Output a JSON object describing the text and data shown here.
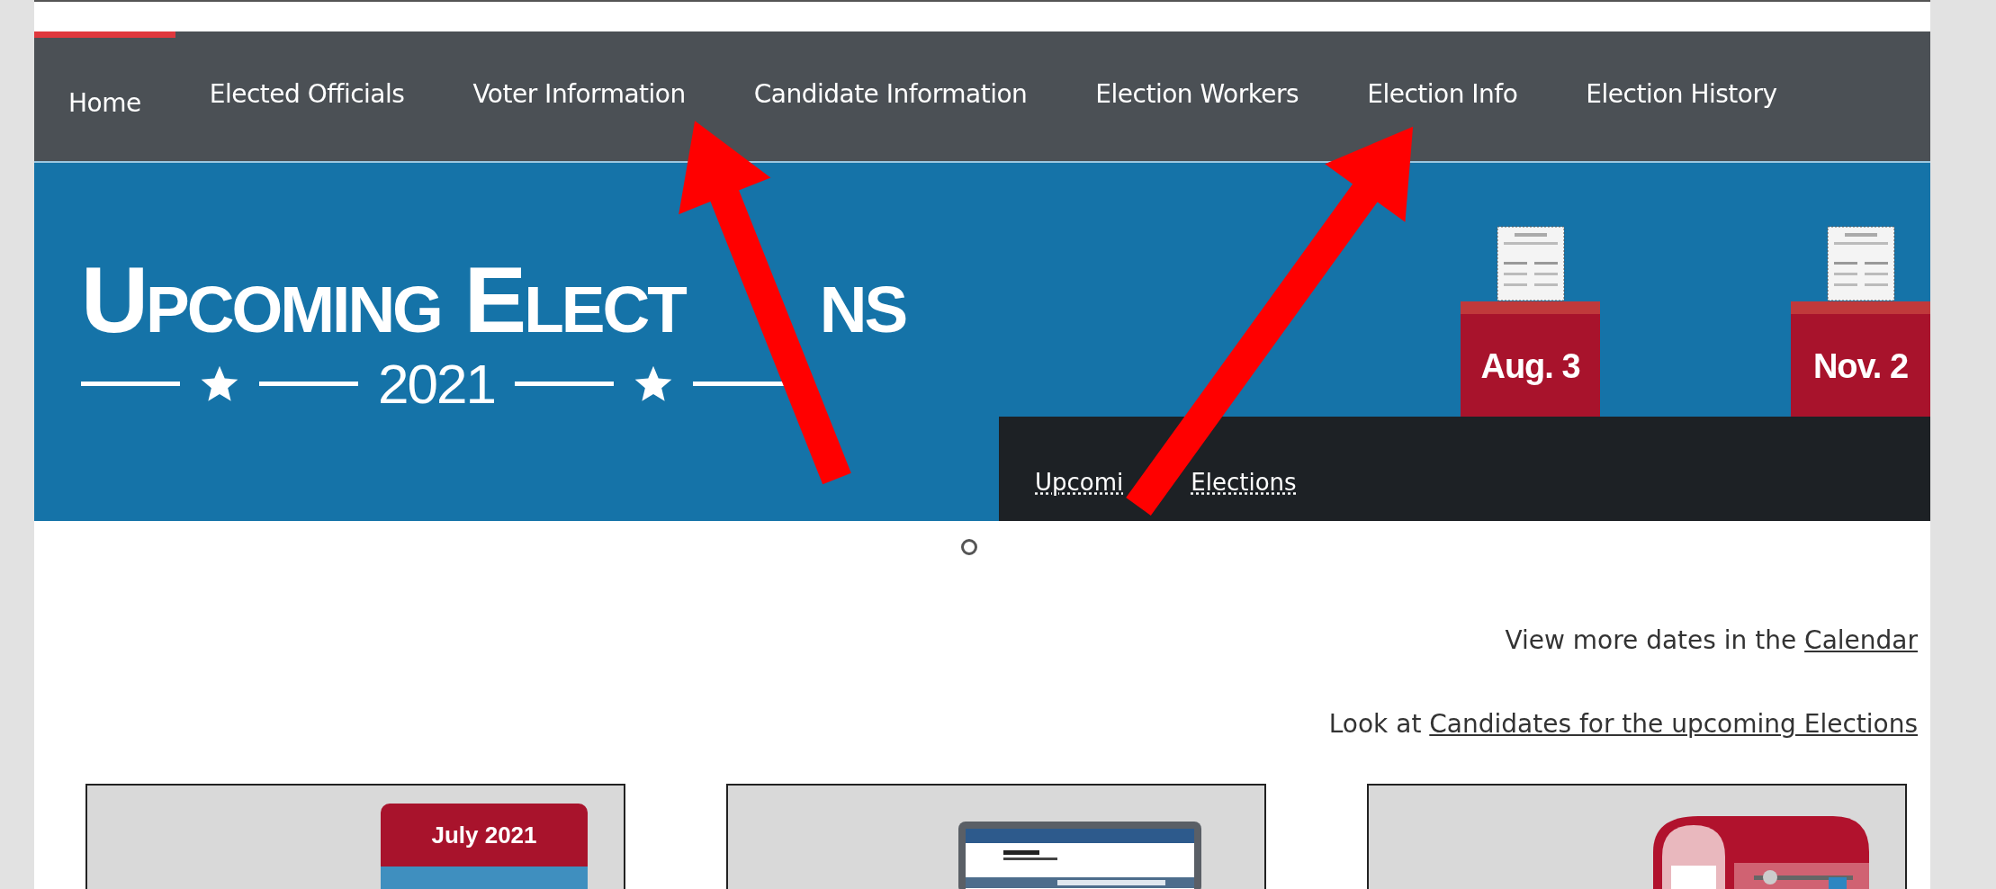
{
  "nav": {
    "items": [
      {
        "label": "Home",
        "selected": true
      },
      {
        "label": "Elected Officials",
        "selected": false
      },
      {
        "label": "Voter Information",
        "selected": false
      },
      {
        "label": "Candidate Information",
        "selected": false
      },
      {
        "label": "Election Workers",
        "selected": false
      },
      {
        "label": "Election Info",
        "selected": false
      },
      {
        "label": "Election History",
        "selected": false
      }
    ]
  },
  "banner": {
    "title_parts": [
      "Upcoming Elect",
      "ns"
    ],
    "year": "2021",
    "dates": [
      "Aug. 3",
      "Nov. 2"
    ],
    "caption_link_parts": [
      "Upcomi",
      "Elections"
    ]
  },
  "info_lines": [
    {
      "text": "View more dates in the ",
      "link": "Calendar"
    },
    {
      "text": "Look at ",
      "link": "Candidates for the upcoming Elections"
    }
  ],
  "cards": [
    {
      "kind": "calendar",
      "label": "July 2021"
    },
    {
      "kind": "laptop"
    },
    {
      "kind": "mailbox"
    }
  ]
}
